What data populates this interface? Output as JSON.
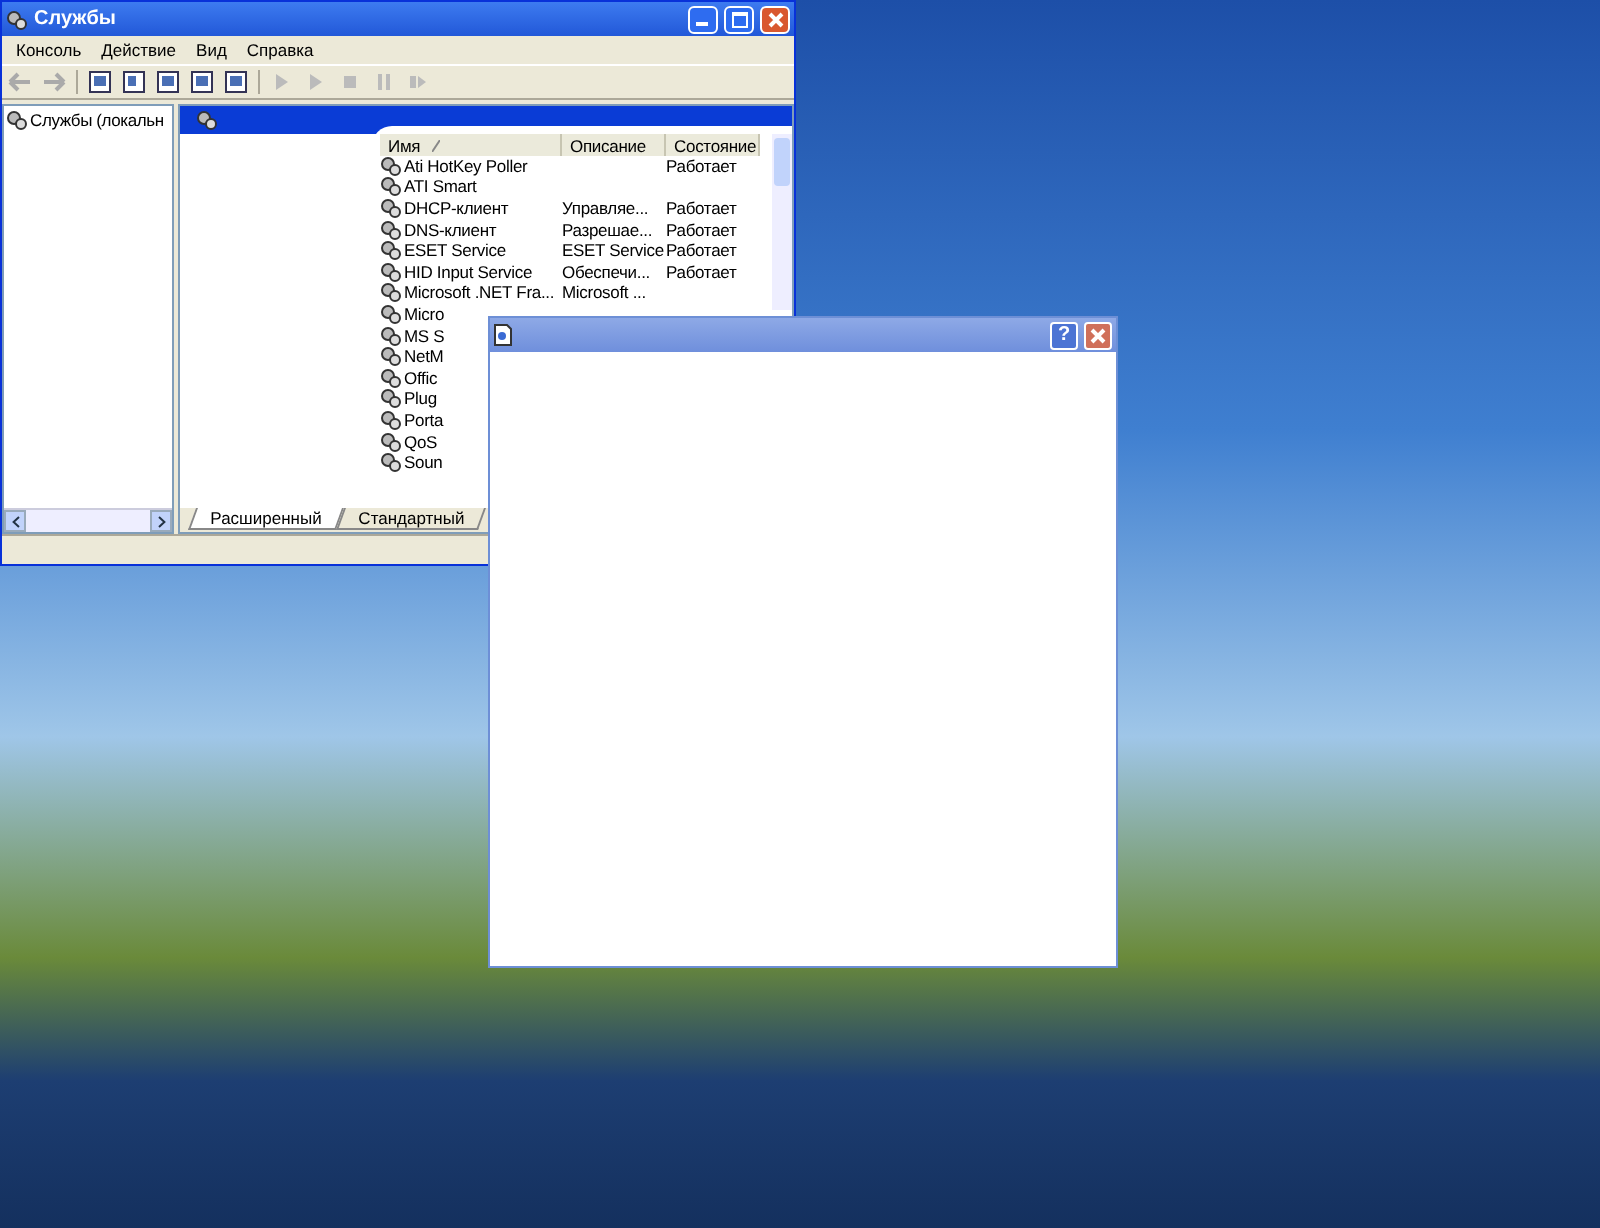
{
  "services_window": {
    "title": "Службы",
    "menu": [
      "Консоль",
      "Действие",
      "Вид",
      "Справка"
    ],
    "tree": [
      {
        "label": "Службы (локальн",
        "selected": false
      }
    ],
    "columns": [
      "Имя",
      "Описание",
      "Состояние"
    ],
    "rows": [
      {
        "name": "Ati HotKey Poller",
        "description": "",
        "state": "Работает"
      },
      {
        "name": "ATI Smart",
        "description": "",
        "state": ""
      },
      {
        "name": "DHCP-клиент",
        "description": "Управляе...",
        "state": "Работает"
      },
      {
        "name": "DNS-клиент",
        "description": "Разрешае...",
        "state": "Работает"
      },
      {
        "name": "ESET Service",
        "description": "ESET Service",
        "state": "Работает"
      },
      {
        "name": "HID Input Service",
        "description": "Обеспечи...",
        "state": "Работает"
      },
      {
        "name": "Microsoft .NET Fra...",
        "description": "Microsoft ...",
        "state": ""
      },
      {
        "name": "Micro",
        "description": "",
        "state": ""
      },
      {
        "name": "MS S",
        "description": "",
        "state": ""
      },
      {
        "name": "NetM",
        "description": "",
        "state": ""
      },
      {
        "name": "Offic",
        "description": "",
        "state": ""
      },
      {
        "name": "Plug",
        "description": "",
        "state": ""
      },
      {
        "name": "Porta",
        "description": "",
        "state": ""
      },
      {
        "name": "QoS",
        "description": "",
        "state": ""
      },
      {
        "name": "Soun",
        "description": "",
        "state": ""
      }
    ],
    "tabs": [
      {
        "label": "Расширенный",
        "selected": true
      },
      {
        "label": "Стандартный",
        "selected": false
      }
    ]
  },
  "dialog": {
    "help_button": "?"
  }
}
